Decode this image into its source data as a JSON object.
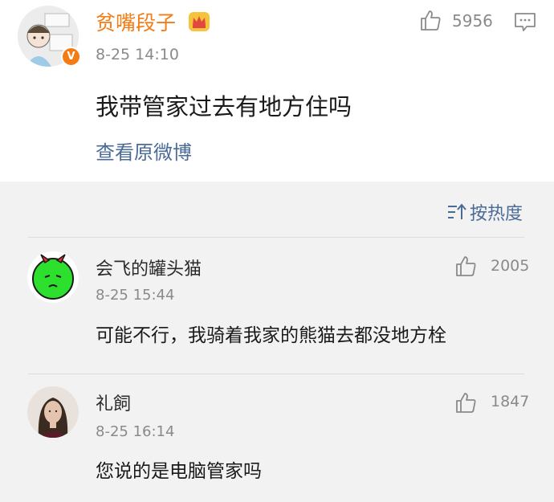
{
  "post": {
    "author": "贫嘴段子",
    "verified_badge": "V",
    "timestamp": "8-25 14:10",
    "likes": "5956",
    "text": "我带管家过去有地方住吗",
    "view_original_label": "查看原微博",
    "icons": [
      "crown-icon",
      "thumbs-up-icon",
      "comment-icon"
    ],
    "colors": {
      "author": "#f37c15",
      "link": "#4a6b97"
    }
  },
  "sort": {
    "label": "按热度",
    "icon": "sort-icon"
  },
  "comments": [
    {
      "author": "会飞的罐头猫",
      "timestamp": "8-25 15:44",
      "likes": "2005",
      "text": "可能不行，我骑着我家的熊猫去都没地方栓"
    },
    {
      "author": "礼飼",
      "timestamp": "8-25 16:14",
      "likes": "1847",
      "text": "您说的是电脑管家吗"
    }
  ]
}
